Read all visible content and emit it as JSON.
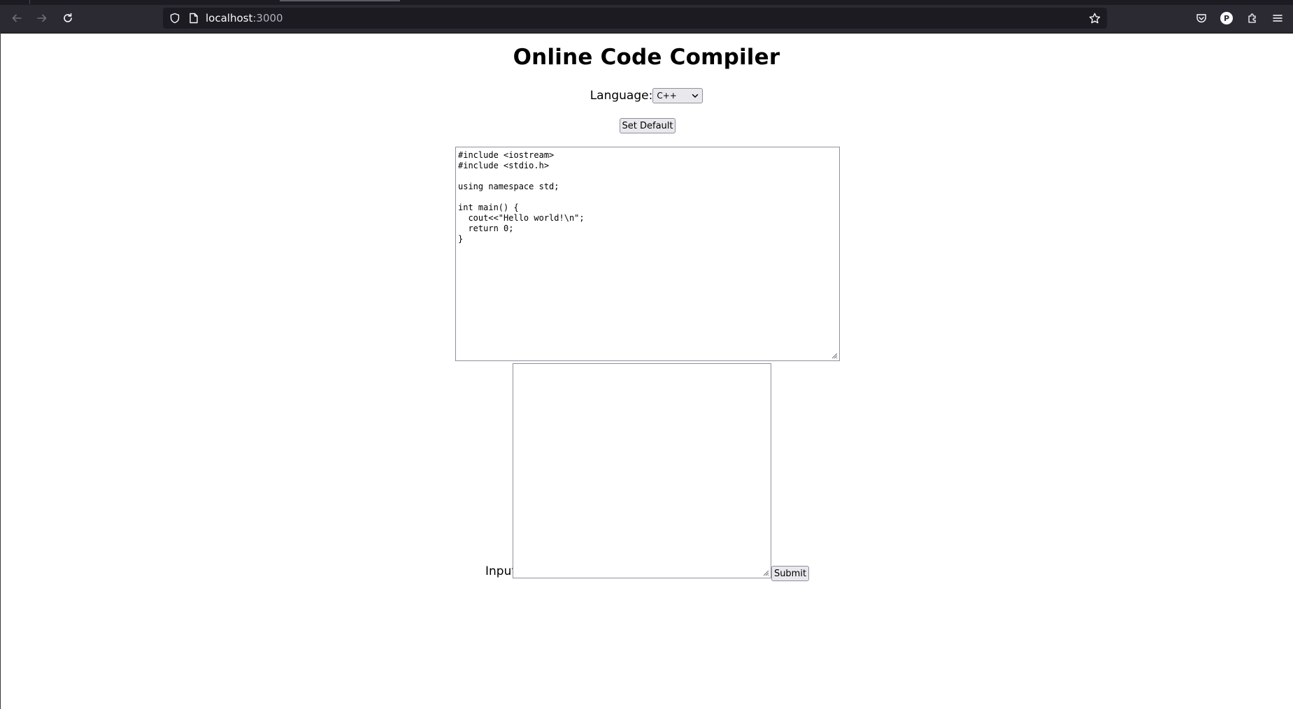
{
  "browser": {
    "url_host": "localhost",
    "url_port": ":3000",
    "icons": {
      "back": "back-arrow-icon",
      "forward": "forward-arrow-icon",
      "reload": "reload-icon",
      "site_info": "shield-icon",
      "page": "page-icon",
      "bookmark": "star-icon",
      "pocket": "pocket-icon",
      "account": "account-avatar-icon",
      "extensions": "puzzle-icon",
      "menu": "hamburger-menu-icon"
    },
    "account_initial": "P"
  },
  "page": {
    "title": "Online Code Compiler",
    "language_label": "Language:",
    "language_selected": "C++",
    "set_default_label": "Set Default",
    "code": "#include <iostream>\n#include <stdio.h>\n\nusing namespace std;\n\nint main() {\n  cout<<\"Hello world!\\n\";\n  return 0;\n}",
    "input_label": "Input",
    "input_value": "",
    "submit_label": "Submit"
  },
  "colors": {
    "chrome_bg": "#2b2a33",
    "urlbar_bg": "#1c1b22",
    "page_bg": "#ffffff",
    "button_bg": "#e9e9ed",
    "control_border": "#8f8f9d"
  }
}
